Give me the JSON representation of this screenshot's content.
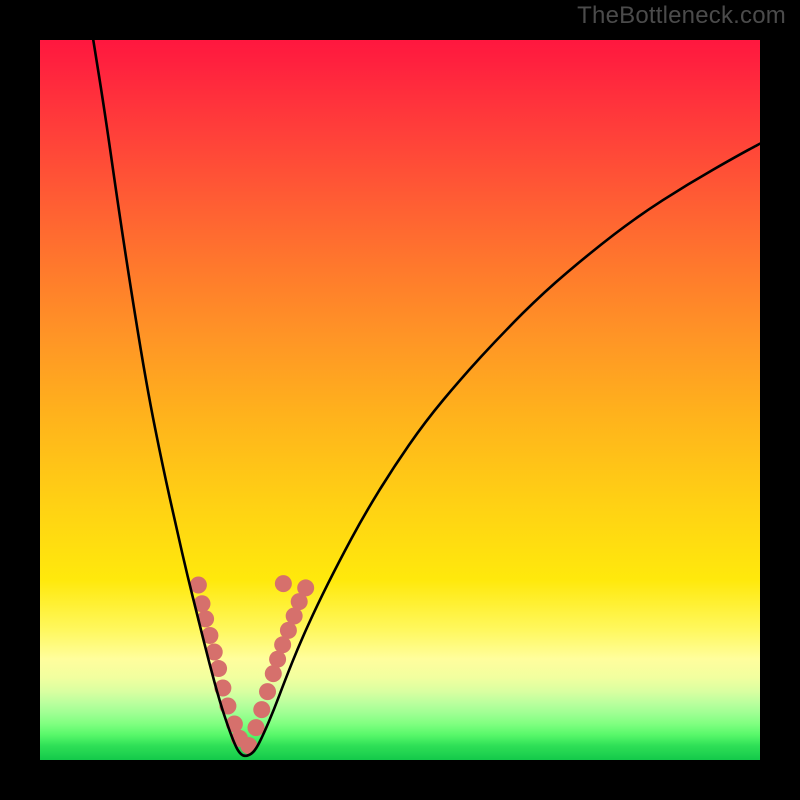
{
  "watermark": "TheBottleneck.com",
  "chart_data": {
    "type": "line",
    "title": "",
    "xlabel": "",
    "ylabel": "",
    "xlim": [
      0,
      100
    ],
    "ylim": [
      0,
      100
    ],
    "grid": false,
    "legend": false,
    "background_gradient": {
      "stops": [
        {
          "pos": 0,
          "color": "#ff173f"
        },
        {
          "pos": 0.75,
          "color": "#ffe90c"
        },
        {
          "pos": 0.88,
          "color": "#fcff9e"
        },
        {
          "pos": 1.0,
          "color": "#13c94a"
        }
      ]
    },
    "series": [
      {
        "name": "curve",
        "stroke": "#000000",
        "stroke_width": 2.6,
        "comment": "V-shaped curve; y is plotted downward from top. Points are (x%, y%_from_top).",
        "points": [
          [
            7.4,
            0.0
          ],
          [
            9.0,
            10.0
          ],
          [
            11.0,
            24.0
          ],
          [
            13.0,
            37.0
          ],
          [
            15.0,
            49.0
          ],
          [
            17.0,
            59.0
          ],
          [
            19.0,
            68.0
          ],
          [
            20.5,
            74.5
          ],
          [
            22.0,
            80.5
          ],
          [
            23.5,
            86.5
          ],
          [
            25.0,
            92.0
          ],
          [
            26.2,
            95.6
          ],
          [
            27.0,
            97.7
          ],
          [
            27.6,
            98.9
          ],
          [
            28.3,
            99.5
          ],
          [
            29.2,
            99.3
          ],
          [
            30.0,
            98.5
          ],
          [
            31.0,
            96.5
          ],
          [
            32.5,
            93.0
          ],
          [
            34.0,
            89.0
          ],
          [
            36.0,
            84.0
          ],
          [
            38.5,
            78.5
          ],
          [
            41.5,
            72.5
          ],
          [
            45.0,
            66.0
          ],
          [
            49.0,
            59.5
          ],
          [
            53.5,
            53.0
          ],
          [
            58.5,
            47.0
          ],
          [
            64.0,
            41.0
          ],
          [
            70.0,
            35.0
          ],
          [
            76.5,
            29.5
          ],
          [
            83.0,
            24.5
          ],
          [
            90.0,
            20.0
          ],
          [
            97.0,
            16.0
          ],
          [
            100.0,
            14.4
          ]
        ]
      },
      {
        "name": "highlight_dots",
        "stroke": "none",
        "fill": "#d6706c",
        "r": 8.5,
        "comment": "Salmon dots clustered near the bottom of the V. (x%, y%_from_top)",
        "points": [
          [
            22.0,
            75.7
          ],
          [
            22.5,
            78.3
          ],
          [
            23.0,
            80.4
          ],
          [
            23.6,
            82.7
          ],
          [
            24.2,
            85.0
          ],
          [
            24.8,
            87.3
          ],
          [
            25.4,
            90.0
          ],
          [
            26.1,
            92.5
          ],
          [
            27.0,
            95.0
          ],
          [
            27.7,
            97.0
          ],
          [
            29.0,
            98.0
          ],
          [
            30.0,
            95.5
          ],
          [
            30.8,
            93.0
          ],
          [
            31.6,
            90.5
          ],
          [
            32.4,
            88.0
          ],
          [
            33.0,
            86.0
          ],
          [
            33.7,
            84.0
          ],
          [
            34.5,
            82.0
          ],
          [
            35.3,
            80.0
          ],
          [
            36.0,
            78.0
          ],
          [
            36.9,
            76.1
          ],
          [
            33.8,
            75.5
          ]
        ]
      }
    ]
  }
}
